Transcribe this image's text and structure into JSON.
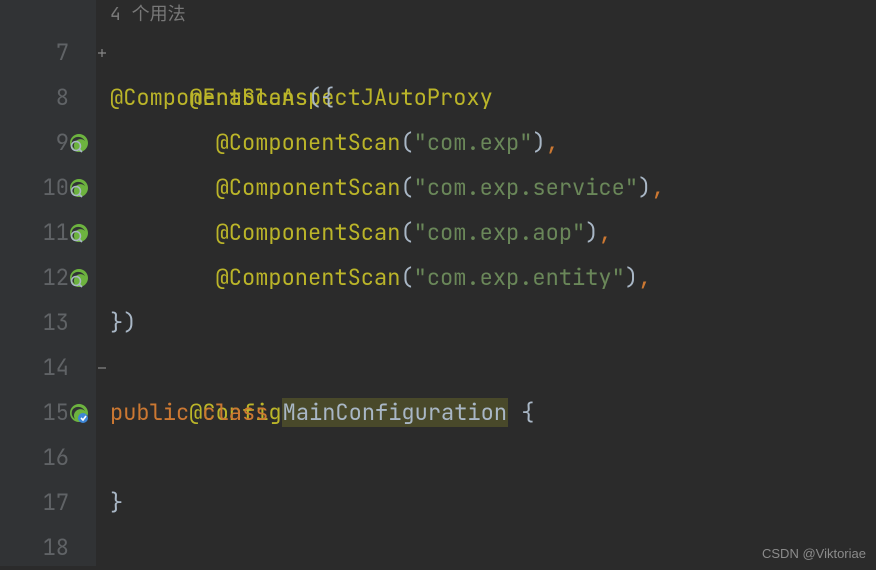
{
  "hint": "4 个用法",
  "gutter": {
    "start": 7,
    "end": 18,
    "bean_lines": [
      9,
      10,
      11,
      12
    ],
    "class_line": 15,
    "fold_open_line": 7,
    "fold_close_line": 14
  },
  "code": {
    "l7": {
      "ann": "@EnableAspectJAutoProxy"
    },
    "l8": {
      "ann": "@ComponentScans",
      "open": "({"
    },
    "l9": {
      "ann": "@ComponentScan",
      "op": "(",
      "str": "\"com.exp\"",
      "cp": ")",
      "comma": ","
    },
    "l10": {
      "ann": "@ComponentScan",
      "op": "(",
      "str": "\"com.exp.service\"",
      "cp": ")",
      "comma": ","
    },
    "l11": {
      "ann": "@ComponentScan",
      "op": "(",
      "str": "\"com.exp.aop\"",
      "cp": ")",
      "comma": ","
    },
    "l12": {
      "ann": "@ComponentScan",
      "op": "(",
      "str": "\"com.exp.entity\"",
      "cp": ")",
      "comma": ","
    },
    "l13": {
      "close": "})"
    },
    "l14": {
      "ann": "@Configuration"
    },
    "l15": {
      "kw1": "public",
      "kw2": "class",
      "cls": "MainConfiguration",
      "brace": " {"
    },
    "l17": {
      "brace": "}"
    }
  },
  "watermark": "CSDN @Viktoriae"
}
